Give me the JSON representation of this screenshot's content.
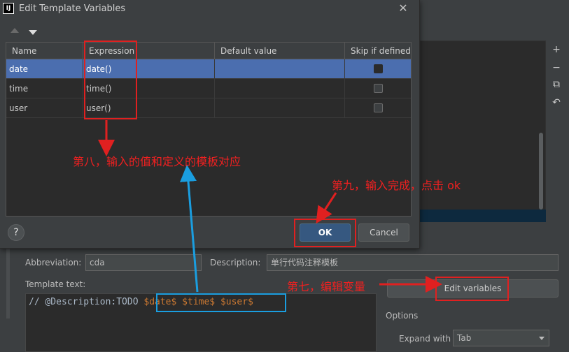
{
  "dialog": {
    "title": "Edit Template Variables",
    "app_icon": "IJ",
    "close_glyph": "✕",
    "columns": [
      "Name",
      "Expression",
      "Default value",
      "Skip if defined"
    ],
    "rows": [
      {
        "name": "date",
        "expression": "date()",
        "default": ""
      },
      {
        "name": "time",
        "expression": "time()",
        "default": ""
      },
      {
        "name": "user",
        "expression": "user()",
        "default": ""
      }
    ],
    "help_label": "?",
    "ok_label": "OK",
    "cancel_label": "Cancel"
  },
  "side_tools": [
    "+",
    "−",
    "⧉",
    "↶"
  ],
  "form": {
    "abbreviation_label": "Abbreviation:",
    "abbreviation_value": "cda",
    "description_label": "Description:",
    "description_value": "单行代码注释模板",
    "template_text_label": "Template text:",
    "code_prefix": "// @Description:TODO ",
    "code_vars": "$date$ $time$ $user$",
    "edit_variables_label": "Edit variables",
    "options_label": "Options",
    "expand_with_label": "Expand with",
    "expand_with_value": "Tab"
  },
  "annotations": {
    "step8": "第八，输入的值和定义的模板对应",
    "step9": "第九，输入完成，点击 ok",
    "step7": "第七，编辑变量"
  },
  "colors": {
    "annotation_red": "#e02020",
    "annotation_blue": "#1a9ee0",
    "selection": "#4b6eaf",
    "ok_button": "#365880"
  },
  "icons": [
    "sort-up-icon",
    "sort-down-icon",
    "close-icon",
    "help-icon",
    "add-icon",
    "remove-icon",
    "copy-icon",
    "revert-icon",
    "chevron-down-icon"
  ]
}
